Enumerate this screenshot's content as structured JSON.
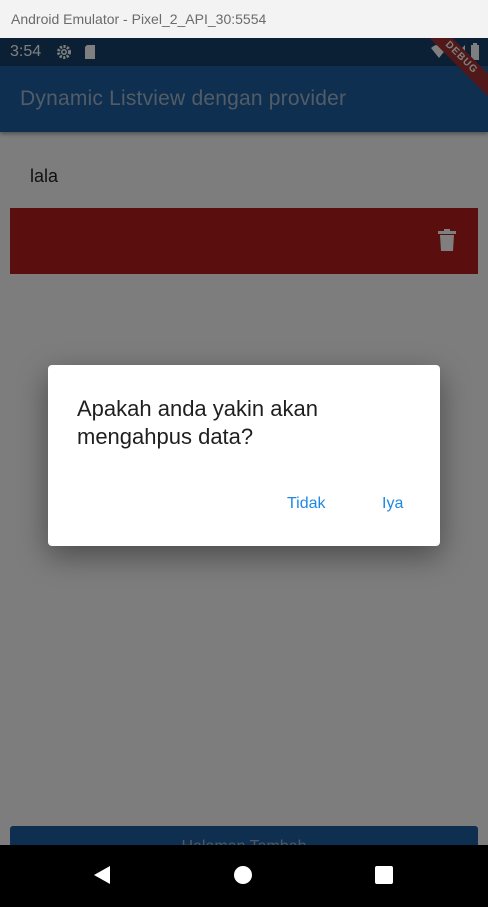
{
  "window": {
    "title": "Android Emulator - Pixel_2_API_30:5554"
  },
  "status_bar": {
    "time": "3:54",
    "icons_left": [
      "gear-icon",
      "sd-card-icon"
    ],
    "icons_right": [
      "wifi-icon",
      "signal-icon",
      "battery-icon"
    ]
  },
  "app_bar": {
    "title": "Dynamic Listview dengan provider",
    "debug_banner": "DEBUG"
  },
  "list": {
    "items": [
      {
        "label": "lala"
      }
    ],
    "dismiss_background_color": "#b71c1c",
    "dismiss_icon": "trash-icon"
  },
  "bottom_button": {
    "label": "Halaman Tambah"
  },
  "dialog": {
    "message": "Apakah anda yakin akan mengahpus data?",
    "cancel_label": "Tidak",
    "confirm_label": "Iya"
  },
  "navigation_bar": {
    "icons": [
      "back-icon",
      "home-icon",
      "recents-icon"
    ]
  },
  "colors": {
    "primary": "#1c5f9e",
    "status_bar": "#17406b",
    "accent": "#1e88e5"
  }
}
